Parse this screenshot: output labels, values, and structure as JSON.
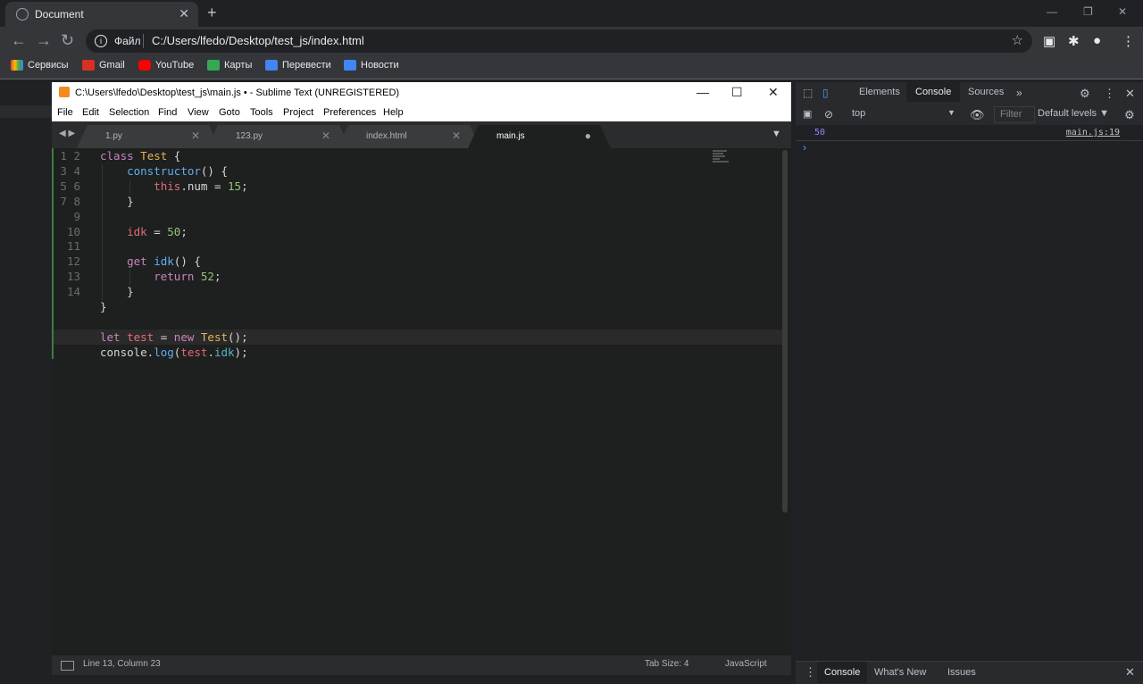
{
  "browser": {
    "tab_title": "Document",
    "scheme_label": "Файл",
    "url": "C:/Users/lfedo/Desktop/test_js/index.html",
    "bookmarks": [
      {
        "label": "Сервисы",
        "color": "#ea4335"
      },
      {
        "label": "Gmail",
        "color": "#d93025"
      },
      {
        "label": "YouTube",
        "color": "#ff0000"
      },
      {
        "label": "Карты",
        "color": "#34a853"
      },
      {
        "label": "Перевести",
        "color": "#4285f4"
      },
      {
        "label": "Новости",
        "color": "#4285f4"
      }
    ]
  },
  "sublime": {
    "title": "C:\\Users\\lfedo\\Desktop\\test_js\\main.js • - Sublime Text (UNREGISTERED)",
    "menu": [
      "File",
      "Edit",
      "Selection",
      "Find",
      "View",
      "Goto",
      "Tools",
      "Project",
      "Preferences",
      "Help"
    ],
    "tabs": [
      {
        "label": "1.py",
        "active": false
      },
      {
        "label": "123.py",
        "active": false
      },
      {
        "label": "index.html",
        "active": false
      },
      {
        "label": "main.js",
        "active": true
      }
    ],
    "line_numbers": "1\n2\n3\n4\n5\n6\n7\n8\n9\n10\n11\n12\n13\n14",
    "status_position": "Line 13, Column 23",
    "tab_size": "Tab Size: 4",
    "syntax": "JavaScript"
  },
  "devtools": {
    "tabs": [
      "Elements",
      "Console",
      "Sources"
    ],
    "context": "top",
    "filter_placeholder": "Filter",
    "levels": "Default levels ▼",
    "log_value": "50",
    "log_source": "main.js:19",
    "drawer_tabs": [
      "Console",
      "What's New",
      "Issues"
    ]
  }
}
